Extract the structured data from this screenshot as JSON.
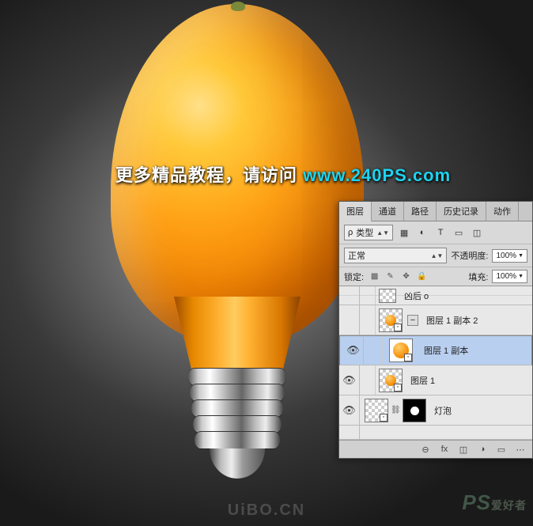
{
  "promo": {
    "text_cn": "更多精品教程，请访问",
    "url": "www.240PS.com"
  },
  "watermark": {
    "ps": "PS",
    "ps_sub": "爱好者",
    "uibo": "UiBO.CN"
  },
  "panel": {
    "tabs": [
      "图层",
      "通道",
      "路径",
      "历史记录",
      "动作"
    ],
    "active_tab": 0,
    "filter_label": "类型",
    "filter_icons": [
      "▦",
      "◐",
      "T",
      "▭",
      "◫"
    ],
    "blend_mode": "正常",
    "opacity_label": "不透明度:",
    "opacity_value": "100%",
    "lock_label": "锁定:",
    "fill_label": "填充:",
    "fill_value": "100%",
    "layers": [
      {
        "name": "凶后 o",
        "visible": false,
        "selected": false,
        "kind": "half"
      },
      {
        "name": "图层 1 副本 2",
        "visible": false,
        "selected": false,
        "kind": "orange-collapse"
      },
      {
        "name": "图层 1 副本",
        "visible": true,
        "selected": true,
        "kind": "orange"
      },
      {
        "name": "图层 1",
        "visible": true,
        "selected": false,
        "kind": "orange-small"
      },
      {
        "name": "灯泡",
        "visible": true,
        "selected": false,
        "kind": "bulb-mask"
      }
    ],
    "footer_icons": [
      "⊖",
      "fx",
      "◫",
      "◑",
      "▭",
      "⋯"
    ]
  }
}
